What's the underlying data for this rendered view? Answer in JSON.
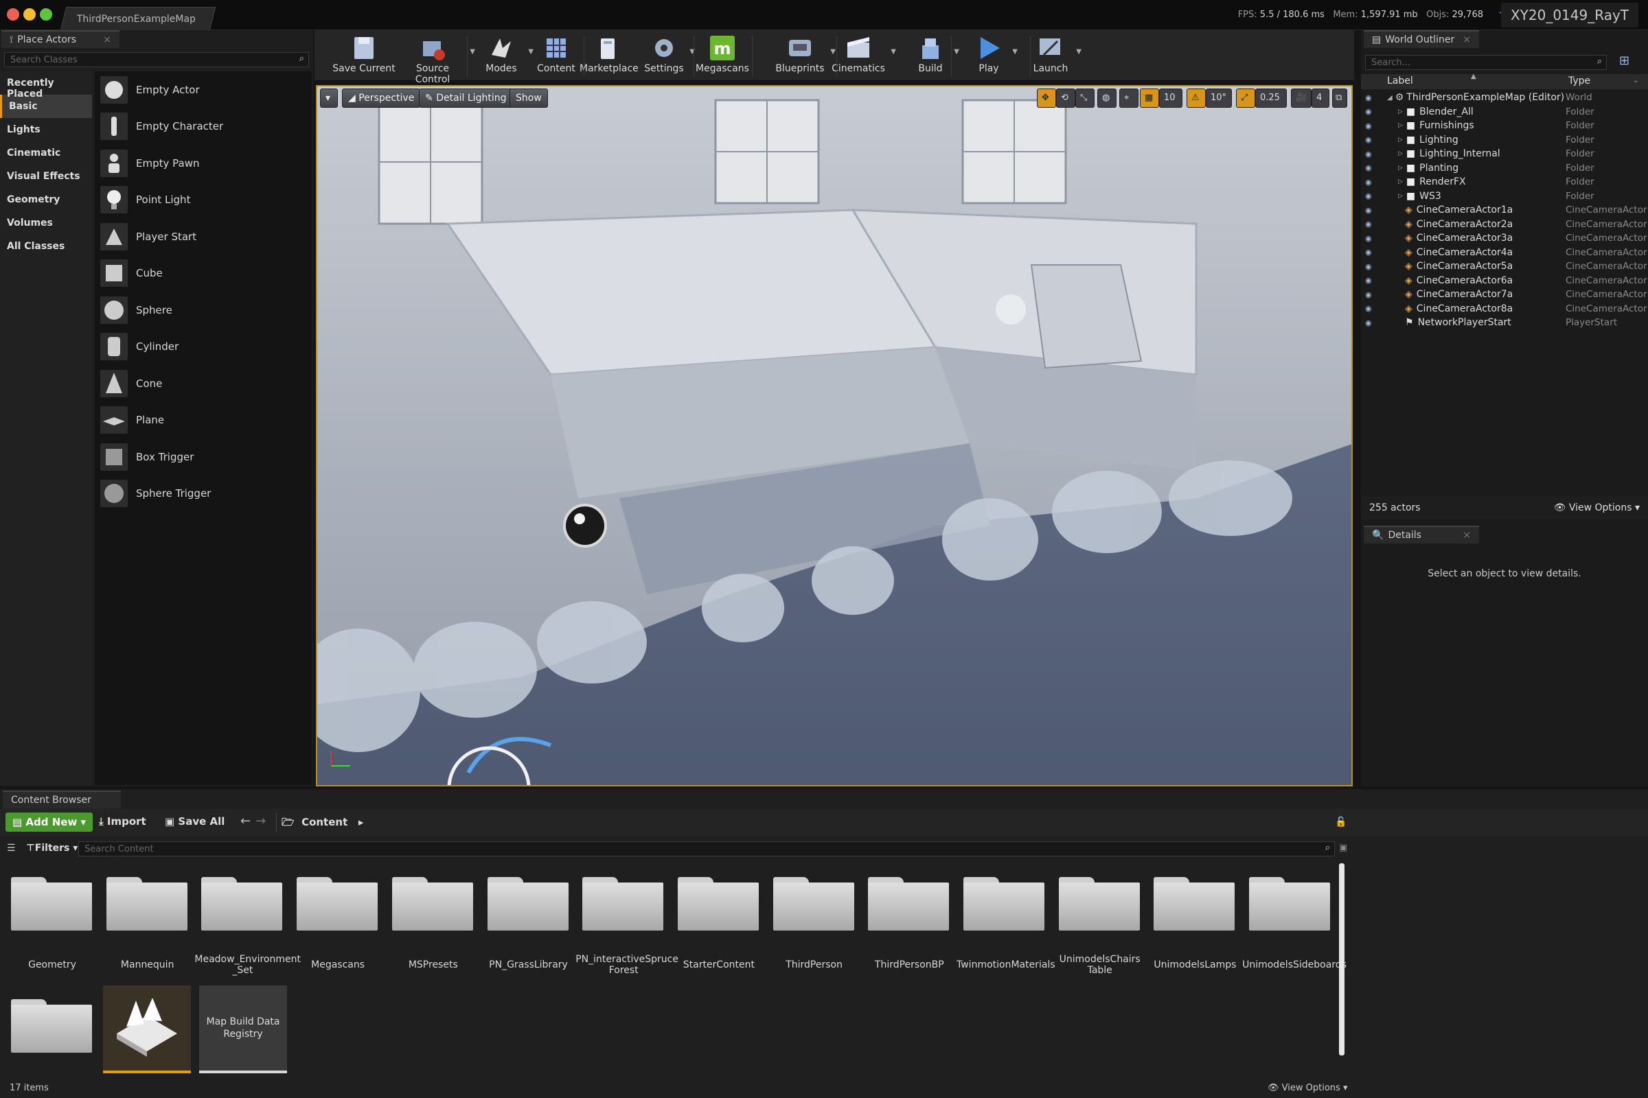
{
  "window": {
    "doc_tab": "ThirdPersonExampleMap",
    "project": "XY20_0149_RayT"
  },
  "stats": {
    "fps_label": "FPS:",
    "fps": "5.5",
    "ms": "/ 180.6 ms",
    "mem_label": "Mem:",
    "mem": "1,597.91 mb",
    "objs_label": "Objs:",
    "objs": "29,768"
  },
  "place_actors": {
    "tab": "Place Actors",
    "search_placeholder": "Search Classes",
    "categories": [
      "Recently Placed",
      "Basic",
      "Lights",
      "Cinematic",
      "Visual Effects",
      "Geometry",
      "Volumes",
      "All Classes"
    ],
    "selected_category": "Basic",
    "items": [
      "Empty Actor",
      "Empty Character",
      "Empty Pawn",
      "Point Light",
      "Player Start",
      "Cube",
      "Sphere",
      "Cylinder",
      "Cone",
      "Plane",
      "Box Trigger",
      "Sphere Trigger"
    ]
  },
  "toolbar": {
    "buttons": [
      {
        "label": "Save Current",
        "icon": "save-icon"
      },
      {
        "label": "Source Control",
        "icon": "source-control-icon"
      },
      {
        "label": "Modes",
        "icon": "modes-icon"
      },
      {
        "label": "Content",
        "icon": "content-icon"
      },
      {
        "label": "Marketplace",
        "icon": "marketplace-icon"
      },
      {
        "label": "Settings",
        "icon": "settings-icon"
      },
      {
        "label": "Megascans",
        "icon": "megascans-icon"
      },
      {
        "label": "Blueprints",
        "icon": "blueprints-icon"
      },
      {
        "label": "Cinematics",
        "icon": "cinematics-icon"
      },
      {
        "label": "Build",
        "icon": "build-icon"
      },
      {
        "label": "Play",
        "icon": "play-icon"
      },
      {
        "label": "Launch",
        "icon": "launch-icon"
      }
    ],
    "megascans_color": "#6bb830",
    "play_color": "#4c8fe0"
  },
  "viewport": {
    "perspective": "Perspective",
    "lighting": "Detail Lighting",
    "show": "Show",
    "grid_snap": "10",
    "rot_snap": "10°",
    "scale_snap": "0.25",
    "camera_speed": "4",
    "accent": "#d9951a"
  },
  "outliner": {
    "tab": "World Outliner",
    "search_placeholder": "Search...",
    "col_label": "Label",
    "col_type": "Type",
    "rows": [
      {
        "label": "ThirdPersonExampleMap (Editor)",
        "type": "World",
        "kind": "world"
      },
      {
        "label": "Blender_All",
        "type": "Folder",
        "kind": "folder"
      },
      {
        "label": "Furnishings",
        "type": "Folder",
        "kind": "folder"
      },
      {
        "label": "Lighting",
        "type": "Folder",
        "kind": "folder"
      },
      {
        "label": "Lighting_Internal",
        "type": "Folder",
        "kind": "folder"
      },
      {
        "label": "Planting",
        "type": "Folder",
        "kind": "folder"
      },
      {
        "label": "RenderFX",
        "type": "Folder",
        "kind": "folder"
      },
      {
        "label": "WS3",
        "type": "Folder",
        "kind": "folder"
      },
      {
        "label": "CineCameraActor1a",
        "type": "CineCameraActor",
        "kind": "camera"
      },
      {
        "label": "CineCameraActor2a",
        "type": "CineCameraActor",
        "kind": "camera"
      },
      {
        "label": "CineCameraActor3a",
        "type": "CineCameraActor",
        "kind": "camera"
      },
      {
        "label": "CineCameraActor4a",
        "type": "CineCameraActor",
        "kind": "camera"
      },
      {
        "label": "CineCameraActor5a",
        "type": "CineCameraActor",
        "kind": "camera"
      },
      {
        "label": "CineCameraActor6a",
        "type": "CineCameraActor",
        "kind": "camera"
      },
      {
        "label": "CineCameraActor7a",
        "type": "CineCameraActor",
        "kind": "camera"
      },
      {
        "label": "CineCameraActor8a",
        "type": "CineCameraActor",
        "kind": "camera"
      },
      {
        "label": "NetworkPlayerStart",
        "type": "PlayerStart",
        "kind": "player"
      }
    ],
    "actor_count": "255 actors",
    "view_options": "View Options"
  },
  "details": {
    "tab": "Details",
    "empty": "Select an object to view details."
  },
  "content_browser": {
    "tab": "Content Browser",
    "add_new": "Add New",
    "import": "Import",
    "save_all": "Save All",
    "path": "Content",
    "filters": "Filters",
    "search_placeholder": "Search Content",
    "folders": [
      "Geometry",
      "Mannequin",
      "Meadow_Environment _Set",
      "Megascans",
      "MSPresets",
      "PN_GrassLibrary",
      "PN_interactiveSpruce Forest",
      "StarterContent",
      "ThirdPerson",
      "ThirdPersonBP",
      "TwinmotionMaterials",
      "UnimodelsChairs Table",
      "UnimodelsLamps",
      "UnimodelsSideboards",
      ""
    ],
    "assets": [
      {
        "label": ""
      },
      {
        "label": "Map Build Data Registry"
      }
    ],
    "item_count": "17 items",
    "view_options": "View Options",
    "add_color": "#4a9a2f"
  }
}
